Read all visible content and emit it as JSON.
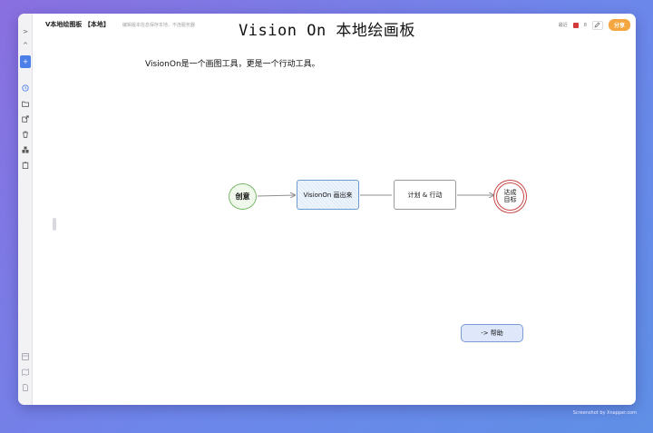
{
  "window": {
    "app_title": "V本地绘图板 【本地】",
    "subtitle_note": "编辑版本信息保存本地，不连服务器",
    "main_title": "Vision On 本地绘画板"
  },
  "topbar": {
    "latest_label": "最近",
    "count": "8",
    "share_label": "分享"
  },
  "sidebar": {
    "expand": ">",
    "collapse_up": "^",
    "active": "+",
    "items": [
      "history",
      "folder",
      "export",
      "trash",
      "library",
      "clipboard"
    ],
    "bottom_items": [
      "panel",
      "map",
      "doc"
    ]
  },
  "canvas": {
    "intro_text": "VisionOn是一个画图工具，更是一个行动工具。",
    "nodes": {
      "idea": "创意",
      "draw": "VisionOn 画出来",
      "plan": "计划 & 行动",
      "goal_line1": "达成",
      "goal_line2": "目标"
    },
    "help_button": "-> 帮助"
  },
  "watermark": "Screenshot by Xnapper.com",
  "colors": {
    "accent": "#4d7fe8",
    "share": "#f4a640",
    "idea_border": "#7bb86a",
    "draw_border": "#6f9ad0",
    "goal_border": "#c94747"
  }
}
